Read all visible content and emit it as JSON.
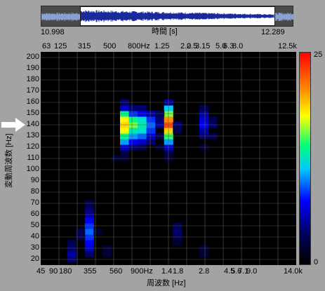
{
  "overview": {
    "start_time": "10.998",
    "end_time": "12.289",
    "axis_label": "時間 [s]"
  },
  "top_axis_ticks": [
    "63",
    "125",
    "315",
    "500",
    "800Hz",
    "1.25",
    "2.0",
    "2.5",
    "3.15",
    "5.0",
    "6.3",
    "8.0",
    "12.5k"
  ],
  "bottom_axis_ticks": [
    "45",
    "90",
    "180",
    "355",
    "560",
    "900Hz",
    "1.4",
    "1.8",
    "2.8",
    "4.5",
    "5.6",
    "7.1",
    "9.0",
    "14.0k"
  ],
  "x_axis_label": "周波数 [Hz]",
  "y_axis_label": "変動周波数 [Hz]",
  "y_ticks": [
    "200",
    "190",
    "180",
    "170",
    "160",
    "150",
    "140",
    "130",
    "120",
    "110",
    "100",
    "90",
    "80",
    "70",
    "60",
    "50",
    "40",
    "30",
    "20"
  ],
  "colorbar": {
    "max_label": "25",
    "min_label": "0"
  },
  "colors": {
    "background": "#a3a3a3",
    "waveform": "#1a2a9a",
    "grid": "#5a5a5a"
  },
  "chart_data": {
    "type": "heatmap",
    "x_label": "周波数 [Hz]",
    "y_label": "変動周波数 [Hz]",
    "y_range": [
      15,
      205
    ],
    "y_step": 5,
    "value_range": [
      0,
      25
    ],
    "num_columns": 29,
    "palette": [
      "#000000",
      "#00005a",
      "#0000ff",
      "#00c8ff",
      "#00ff78",
      "#ffff00",
      "#ff8000",
      "#ff0000"
    ],
    "cells": [
      {
        "col": 3,
        "y": 20,
        "v": 4
      },
      {
        "col": 3,
        "y": 25,
        "v": 5
      },
      {
        "col": 3,
        "y": 30,
        "v": 4
      },
      {
        "col": 3,
        "y": 35,
        "v": 3
      },
      {
        "col": 5,
        "y": 25,
        "v": 4
      },
      {
        "col": 5,
        "y": 30,
        "v": 6
      },
      {
        "col": 5,
        "y": 35,
        "v": 7
      },
      {
        "col": 5,
        "y": 40,
        "v": 8
      },
      {
        "col": 5,
        "y": 45,
        "v": 9
      },
      {
        "col": 5,
        "y": 50,
        "v": 8
      },
      {
        "col": 5,
        "y": 55,
        "v": 7
      },
      {
        "col": 5,
        "y": 60,
        "v": 5
      },
      {
        "col": 5,
        "y": 65,
        "v": 4
      },
      {
        "col": 5,
        "y": 70,
        "v": 3
      },
      {
        "col": 4,
        "y": 40,
        "v": 3
      },
      {
        "col": 4,
        "y": 45,
        "v": 3
      },
      {
        "col": 6,
        "y": 45,
        "v": 2
      },
      {
        "col": 7,
        "y": 25,
        "v": 2
      },
      {
        "col": 7,
        "y": 30,
        "v": 2
      },
      {
        "col": 9,
        "y": 115,
        "v": 3
      },
      {
        "col": 9,
        "y": 120,
        "v": 6
      },
      {
        "col": 9,
        "y": 125,
        "v": 10
      },
      {
        "col": 9,
        "y": 130,
        "v": 14
      },
      {
        "col": 9,
        "y": 135,
        "v": 18
      },
      {
        "col": 9,
        "y": 140,
        "v": 19
      },
      {
        "col": 9,
        "y": 145,
        "v": 18
      },
      {
        "col": 9,
        "y": 150,
        "v": 14
      },
      {
        "col": 9,
        "y": 155,
        "v": 6
      },
      {
        "col": 9,
        "y": 160,
        "v": 4
      },
      {
        "col": 10,
        "y": 120,
        "v": 4
      },
      {
        "col": 10,
        "y": 125,
        "v": 7
      },
      {
        "col": 10,
        "y": 130,
        "v": 10
      },
      {
        "col": 10,
        "y": 135,
        "v": 13
      },
      {
        "col": 10,
        "y": 140,
        "v": 16
      },
      {
        "col": 10,
        "y": 145,
        "v": 14
      },
      {
        "col": 10,
        "y": 150,
        "v": 8
      },
      {
        "col": 10,
        "y": 155,
        "v": 4
      },
      {
        "col": 11,
        "y": 120,
        "v": 3
      },
      {
        "col": 11,
        "y": 125,
        "v": 6
      },
      {
        "col": 11,
        "y": 130,
        "v": 9
      },
      {
        "col": 11,
        "y": 135,
        "v": 12
      },
      {
        "col": 11,
        "y": 140,
        "v": 13
      },
      {
        "col": 11,
        "y": 145,
        "v": 12
      },
      {
        "col": 11,
        "y": 150,
        "v": 7
      },
      {
        "col": 11,
        "y": 155,
        "v": 4
      },
      {
        "col": 12,
        "y": 125,
        "v": 4
      },
      {
        "col": 12,
        "y": 130,
        "v": 6
      },
      {
        "col": 12,
        "y": 135,
        "v": 8
      },
      {
        "col": 12,
        "y": 140,
        "v": 9
      },
      {
        "col": 12,
        "y": 145,
        "v": 8
      },
      {
        "col": 12,
        "y": 150,
        "v": 5
      },
      {
        "col": 13,
        "y": 120,
        "v": 2
      },
      {
        "col": 13,
        "y": 130,
        "v": 3
      },
      {
        "col": 13,
        "y": 140,
        "v": 5
      },
      {
        "col": 13,
        "y": 145,
        "v": 4
      },
      {
        "col": 14,
        "y": 115,
        "v": 3
      },
      {
        "col": 14,
        "y": 120,
        "v": 6
      },
      {
        "col": 14,
        "y": 125,
        "v": 10
      },
      {
        "col": 14,
        "y": 130,
        "v": 15
      },
      {
        "col": 14,
        "y": 135,
        "v": 19
      },
      {
        "col": 14,
        "y": 140,
        "v": 23
      },
      {
        "col": 14,
        "y": 145,
        "v": 21
      },
      {
        "col": 14,
        "y": 150,
        "v": 16
      },
      {
        "col": 14,
        "y": 155,
        "v": 11
      },
      {
        "col": 14,
        "y": 160,
        "v": 5
      },
      {
        "col": 13,
        "y": 150,
        "v": 3
      },
      {
        "col": 15,
        "y": 135,
        "v": 3
      },
      {
        "col": 15,
        "y": 140,
        "v": 4
      },
      {
        "col": 15,
        "y": 40,
        "v": 3
      },
      {
        "col": 15,
        "y": 45,
        "v": 4
      },
      {
        "col": 15,
        "y": 50,
        "v": 3
      },
      {
        "col": 15,
        "y": 35,
        "v": 2
      },
      {
        "col": 18,
        "y": 120,
        "v": 2
      },
      {
        "col": 18,
        "y": 130,
        "v": 4
      },
      {
        "col": 18,
        "y": 135,
        "v": 5
      },
      {
        "col": 18,
        "y": 140,
        "v": 7
      },
      {
        "col": 18,
        "y": 145,
        "v": 6
      },
      {
        "col": 18,
        "y": 150,
        "v": 5
      },
      {
        "col": 18,
        "y": 155,
        "v": 3
      },
      {
        "col": 19,
        "y": 130,
        "v": 3
      },
      {
        "col": 19,
        "y": 140,
        "v": 4
      },
      {
        "col": 19,
        "y": 145,
        "v": 3
      },
      {
        "col": 18,
        "y": 25,
        "v": 2
      },
      {
        "col": 18,
        "y": 30,
        "v": 2
      },
      {
        "col": 8,
        "y": 110,
        "v": 2
      },
      {
        "col": 14,
        "y": 110,
        "v": 2
      },
      {
        "col": 9,
        "y": 110,
        "v": 2
      }
    ]
  }
}
